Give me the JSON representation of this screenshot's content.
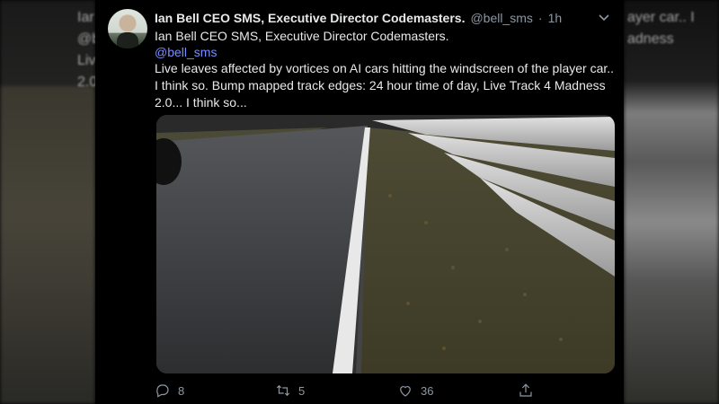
{
  "background": {
    "left_text": [
      "Iar",
      "@be",
      "Liv",
      "2.0"
    ],
    "right_text": [
      "ayer car.. I",
      "adness"
    ]
  },
  "tweet": {
    "display_name": "Ian Bell CEO SMS, Executive Director Codemasters.",
    "handle": "@bell_sms",
    "separator": "·",
    "time": "1h",
    "bio_line": "Ian Bell CEO SMS, Executive Director Codemasters.",
    "mention": "@bell_sms",
    "text": "Live leaves affected by vortices on AI cars hitting the windscreen of the player car.. I think so. Bump mapped track edges: 24 hour time of day, Live Track 4 Madness 2.0... I think so...",
    "media": {
      "description_icon": "race-track-photo",
      "colors": {
        "asphalt": "#3a3a3c",
        "grass": "#4a4a2e",
        "barrier": "#c8c8c8",
        "sky": "#2a2a2a"
      }
    },
    "actions": {
      "reply_count": "8",
      "retweet_count": "5",
      "like_count": "36"
    }
  },
  "colors": {
    "background": "#000000",
    "text_primary": "#e7e9ea",
    "text_secondary": "#8b98a5",
    "link": "#7a8cff"
  }
}
